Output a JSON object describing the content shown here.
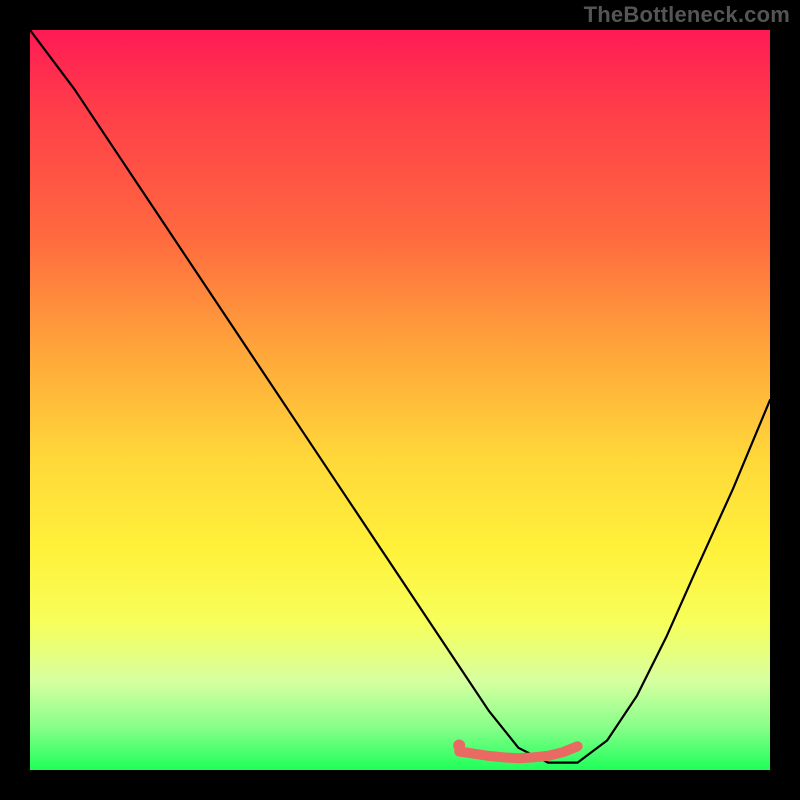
{
  "watermark": "TheBottleneck.com",
  "chart_data": {
    "type": "line",
    "title": "",
    "xlabel": "",
    "ylabel": "",
    "xlim": [
      0,
      100
    ],
    "ylim": [
      0,
      100
    ],
    "grid": false,
    "legend": false,
    "series": [
      {
        "name": "bottleneck-curve",
        "color": "#000000",
        "x": [
          0,
          6,
          12,
          18,
          24,
          30,
          36,
          42,
          48,
          54,
          58,
          62,
          66,
          70,
          74,
          78,
          82,
          86,
          90,
          95,
          100
        ],
        "y": [
          100,
          92,
          83,
          74,
          65,
          56,
          47,
          38,
          29,
          20,
          14,
          8,
          3,
          1,
          1,
          4,
          10,
          18,
          27,
          38,
          50
        ]
      },
      {
        "name": "optimal-range-marker",
        "color": "#e86a62",
        "x": [
          58,
          60,
          62,
          64,
          66,
          68,
          70,
          72,
          74
        ],
        "y": [
          2.5,
          2.2,
          1.9,
          1.7,
          1.6,
          1.7,
          1.9,
          2.4,
          3.2
        ]
      }
    ],
    "gradient_stops": [
      {
        "pos": 0,
        "color": "#ff1a55"
      },
      {
        "pos": 10,
        "color": "#ff3b4a"
      },
      {
        "pos": 28,
        "color": "#ff6a3f"
      },
      {
        "pos": 44,
        "color": "#ffa83a"
      },
      {
        "pos": 58,
        "color": "#ffd83a"
      },
      {
        "pos": 70,
        "color": "#fff13a"
      },
      {
        "pos": 80,
        "color": "#f7ff5a"
      },
      {
        "pos": 88,
        "color": "#d6ffa0"
      },
      {
        "pos": 94,
        "color": "#8bff8b"
      },
      {
        "pos": 100,
        "color": "#1eff5a"
      }
    ]
  }
}
